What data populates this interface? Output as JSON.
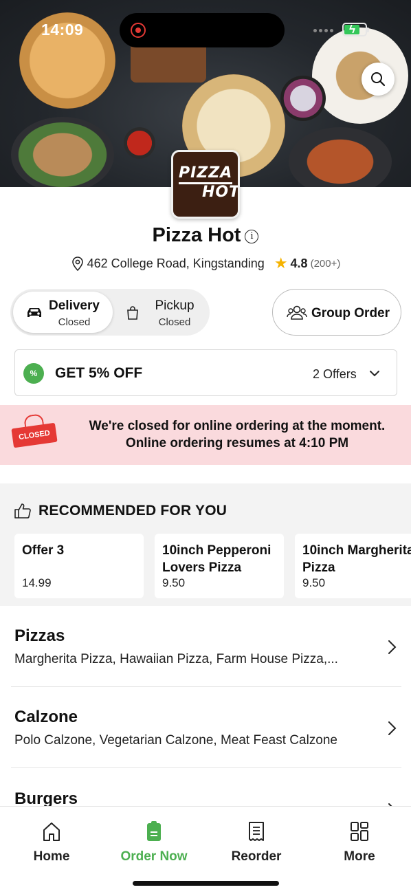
{
  "status_bar": {
    "time": "14:09"
  },
  "restaurant": {
    "logo_text_line1": "PIZZA",
    "logo_text_line2": "HOT",
    "name": "Pizza Hot",
    "address": "462 College Road, Kingstanding",
    "rating": "4.8",
    "rating_count": "(200+)"
  },
  "order_mode": {
    "delivery": {
      "label": "Delivery",
      "status": "Closed",
      "selected": true
    },
    "pickup": {
      "label": "Pickup",
      "status": "Closed",
      "selected": false
    }
  },
  "group_order": {
    "label": "Group Order"
  },
  "offers": {
    "headline": "GET 5% OFF",
    "count_label": "2 Offers",
    "badge_glyph": "%"
  },
  "closed_notice": {
    "sign_text": "CLOSED",
    "line1": "We're closed for online ordering at the moment.",
    "line2": "Online ordering resumes at 4:10 PM"
  },
  "recommended": {
    "heading": "RECOMMENDED FOR YOU",
    "items": [
      {
        "name": "Offer 3",
        "price": "14.99"
      },
      {
        "name": "10inch Pepperoni Lovers Pizza",
        "price": "9.50"
      },
      {
        "name": "10inch Margherita Pizza",
        "price": "9.50"
      }
    ]
  },
  "categories": [
    {
      "title": "Pizzas",
      "items": "Margherita Pizza, Hawaiian Pizza, Farm House Pizza,..."
    },
    {
      "title": "Calzone",
      "items": "Polo Calzone, Vegetarian Calzone, Meat Feast Calzone"
    },
    {
      "title": "Burgers",
      "items": ""
    }
  ],
  "bottom_nav": {
    "items": [
      {
        "label": "Home",
        "icon": "home-icon"
      },
      {
        "label": "Order Now",
        "icon": "order-bag-icon",
        "active": true
      },
      {
        "label": "Reorder",
        "icon": "receipt-icon"
      },
      {
        "label": "More",
        "icon": "grid-icon"
      }
    ]
  },
  "colors": {
    "accent": "#4caf50",
    "closed_banner_bg": "#fadadd",
    "closed_red": "#e53935",
    "star": "#f5b301"
  }
}
